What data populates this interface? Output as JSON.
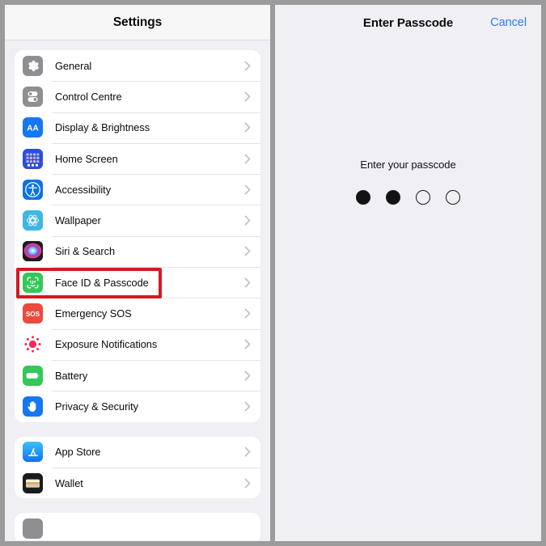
{
  "settings": {
    "header_title": "Settings",
    "groups": [
      {
        "id": "group-main",
        "items": [
          {
            "label": "General",
            "icon": "gear-icon",
            "icon_bg": "#8e8e93",
            "chevron": "chevron-right-icon"
          },
          {
            "label": "Control Centre",
            "icon": "control-centre-icon",
            "icon_bg": "#8e8e93",
            "chevron": "chevron-right-icon"
          },
          {
            "label": "Display & Brightness",
            "icon": "display-brightness-icon",
            "icon_bg": "#1577f2",
            "chevron": "chevron-right-icon"
          },
          {
            "label": "Home Screen",
            "icon": "home-screen-icon",
            "icon_bg": "#2b4fd8",
            "chevron": "chevron-right-icon"
          },
          {
            "label": "Accessibility",
            "icon": "accessibility-icon",
            "icon_bg": "#0b72e8",
            "chevron": "chevron-right-icon"
          },
          {
            "label": "Wallpaper",
            "icon": "wallpaper-icon",
            "icon_bg": "#3fb6e3",
            "chevron": "chevron-right-icon"
          },
          {
            "label": "Siri & Search",
            "icon": "siri-icon",
            "icon_bg": "#1c1c1e",
            "chevron": "chevron-right-icon"
          },
          {
            "label": "Face ID & Passcode",
            "icon": "face-id-icon",
            "icon_bg": "#34c759",
            "chevron": "chevron-right-icon",
            "highlighted": true
          },
          {
            "label": "Emergency SOS",
            "icon": "emergency-sos-icon",
            "icon_bg": "#eb4b3d",
            "chevron": "chevron-right-icon"
          },
          {
            "label": "Exposure Notifications",
            "icon": "exposure-notifications-icon",
            "icon_bg": "#ffffff",
            "chevron": "chevron-right-icon"
          },
          {
            "label": "Battery",
            "icon": "battery-icon",
            "icon_bg": "#34c759",
            "chevron": "chevron-right-icon"
          },
          {
            "label": "Privacy & Security",
            "icon": "privacy-hand-icon",
            "icon_bg": "#1577f2",
            "chevron": "chevron-right-icon"
          }
        ]
      },
      {
        "id": "group-stores",
        "items": [
          {
            "label": "App Store",
            "icon": "app-store-icon",
            "icon_bg": "#1fa2f3",
            "chevron": "chevron-right-icon"
          },
          {
            "label": "Wallet",
            "icon": "wallet-icon",
            "icon_bg": "#1c1c1e",
            "chevron": "chevron-right-icon"
          }
        ]
      }
    ],
    "highlight_color": "#d71921"
  },
  "passcode": {
    "title": "Enter Passcode",
    "cancel_label": "Cancel",
    "prompt": "Enter your passcode",
    "dots_total": 4,
    "dots_filled": 2
  }
}
